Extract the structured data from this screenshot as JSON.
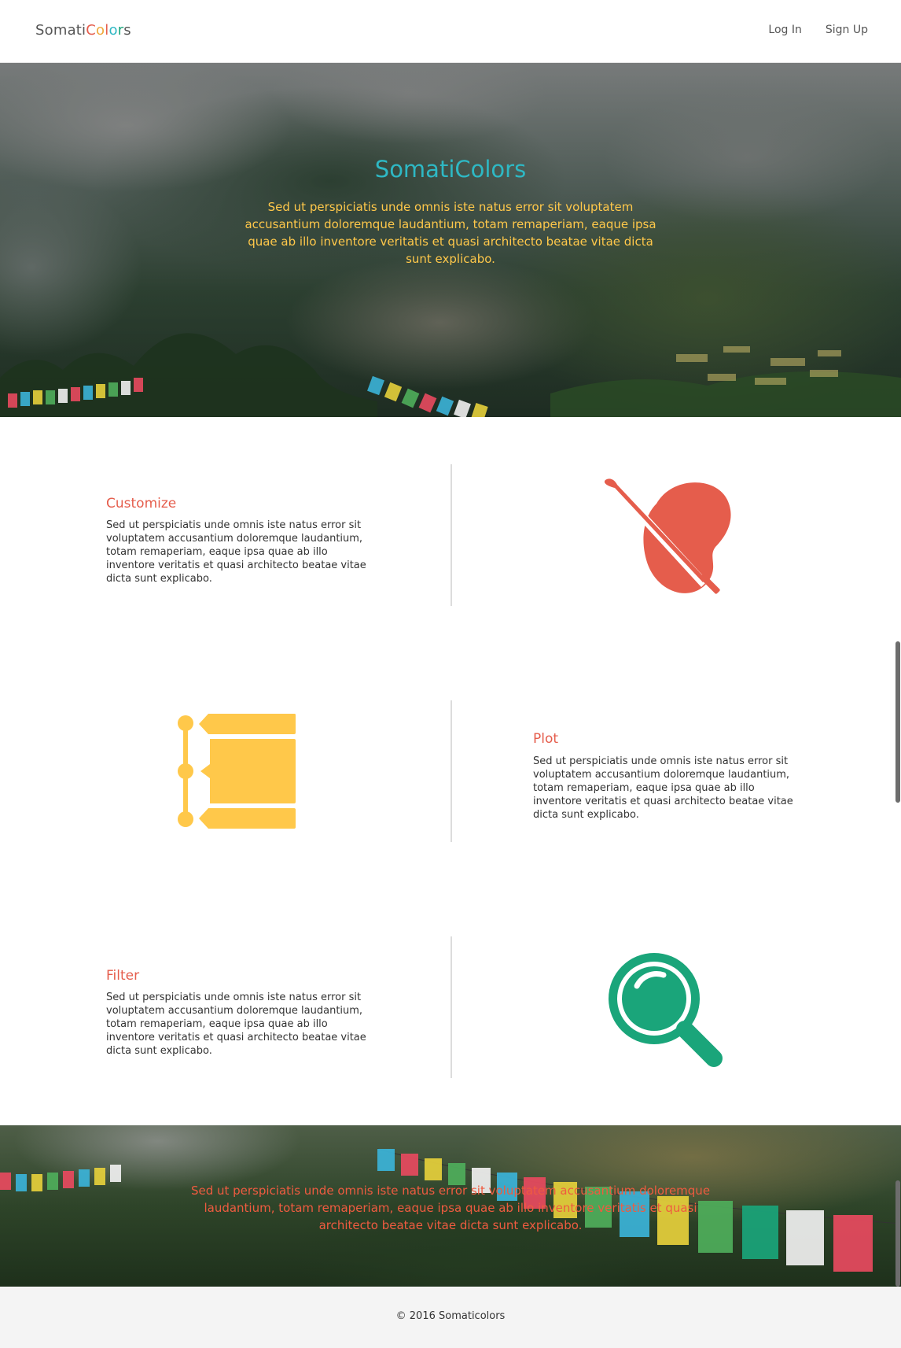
{
  "nav": {
    "brand_parts": [
      {
        "text": "Somati",
        "color": "#555555"
      },
      {
        "text": "C",
        "color": "#e55d4c"
      },
      {
        "text": "o",
        "color": "#f0a93a"
      },
      {
        "text": "l",
        "color": "#e55d4c"
      },
      {
        "text": "o",
        "color": "#2eb8c4"
      },
      {
        "text": "r",
        "color": "#1aa57a"
      },
      {
        "text": "s",
        "color": "#555555"
      }
    ],
    "login": "Log In",
    "signup": "Sign Up"
  },
  "hero": {
    "title": "SomatiColors",
    "text": "Sed ut perspiciatis unde omnis iste natus error sit voluptatem accusantium doloremque laudantium, totam remaperiam, eaque ipsa quae ab illo inventore veritatis et quasi architecto beatae vitae dicta sunt explicabo."
  },
  "features": [
    {
      "title": "Customize",
      "text": "Sed ut perspiciatis unde omnis iste natus error sit voluptatem accusantium doloremque laudantium, totam remaperiam, eaque ipsa quae ab illo inventore veritatis et quasi architecto beatae vitae dicta sunt explicabo.",
      "icon": "palette-brush-icon",
      "color": "#e55d4c"
    },
    {
      "title": "Plot",
      "text": "Sed ut perspiciatis unde omnis iste natus error sit voluptatem accusantium doloremque laudantium, totam remaperiam, eaque ipsa quae ab illo inventore veritatis et quasi architecto beatae vitae dicta sunt explicabo.",
      "icon": "timeline-icon",
      "color": "#ffc84a"
    },
    {
      "title": "Filter",
      "text": "Sed ut perspiciatis unde omnis iste natus error sit voluptatem accusantium doloremque laudantium, totam remaperiam, eaque ipsa quae ab illo inventore veritatis et quasi architecto beatae vitae dicta sunt explicabo.",
      "icon": "magnifier-icon",
      "color": "#1aa57a"
    }
  ],
  "banner": {
    "text": "Sed ut perspiciatis unde omnis iste natus error sit voluptatem accusantium doloremque laudantium, totam remaperiam, eaque ipsa quae ab illo inventore veritatis et quasi architecto beatae vitae dicta sunt explicabo."
  },
  "footer": {
    "copyright": "© 2016 Somaticolors"
  }
}
